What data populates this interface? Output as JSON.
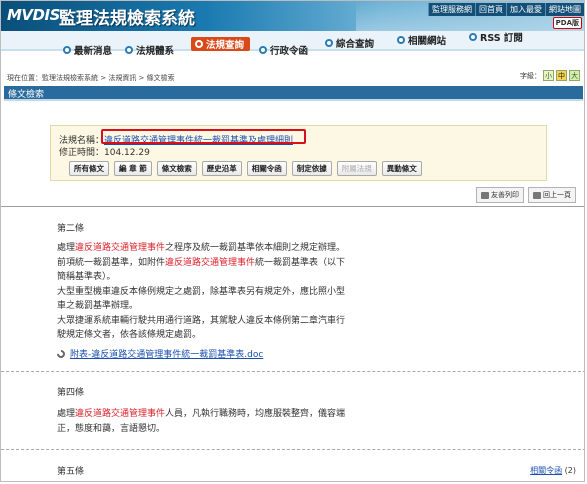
{
  "header": {
    "brand": "MVDIS",
    "title": "監理法規檢索系統",
    "top_links": [
      "監理服務網",
      "回首頁",
      "加入最愛",
      "網站地圖"
    ],
    "pda_label": "PDA版"
  },
  "nav": {
    "items": [
      {
        "label": "最新消息"
      },
      {
        "label": "法規體系"
      },
      {
        "label": "法規查詢"
      },
      {
        "label": "行政令函"
      },
      {
        "label": "綜合查詢"
      },
      {
        "label": "相關網站"
      },
      {
        "label": "RSS 訂閱"
      }
    ]
  },
  "breadcrumb": "現在位置：監理法規檢索系統 > 法規資訊 > 條文檢索",
  "font_size": {
    "label": "字級：",
    "small": "小",
    "medium": "中",
    "large": "大"
  },
  "section_title": "條文檢索",
  "law": {
    "name_label": "法規名稱：",
    "name": "違反道路交通管理事件統一裁罰基準及處理細則",
    "revised_label": "修正時間：",
    "revised": "104.12.29"
  },
  "tabs": [
    "所有條文",
    "編 章 節",
    "條文檢索",
    "歷史沿革",
    "相關令函",
    "制定依據",
    "附屬法規",
    "異動條文"
  ],
  "tools": {
    "print": "友善列印",
    "back": "回上一頁"
  },
  "articles": [
    {
      "title": "第二條",
      "lines": [
        [
          {
            "t": "處理"
          },
          {
            "t": "違反道路交通管理事件",
            "hl": true
          },
          {
            "t": "之程序及統一裁罰基準依本細則之規定辦理。"
          }
        ],
        [
          {
            "t": "前項統一裁罰基準，如附件"
          },
          {
            "t": "違反道路交通管理事件",
            "hl": true
          },
          {
            "t": "統一裁罰基準表（以下"
          }
        ],
        [
          {
            "t": "簡稱基準表）。"
          }
        ],
        [
          {
            "t": "大型重型機車違反本條例規定之處罰，除基準表另有規定外，應比照小型"
          }
        ],
        [
          {
            "t": "車之裁罰基準辦理。"
          }
        ],
        [
          {
            "t": "大眾捷運系統車輛行駛共用通行道路，其駕駛人違反本條例第二章汽車行"
          }
        ],
        [
          {
            "t": "駛規定條文者，依各該條規定處罰。"
          }
        ]
      ],
      "attachment": "附表-違反道路交通管理事件統一裁罰基準表.doc"
    },
    {
      "title": "第四條",
      "lines": [
        [
          {
            "t": "處理"
          },
          {
            "t": "違反道路交通管理事件",
            "hl": true
          },
          {
            "t": "人員，凡執行職務時，均應服裝整齊，儀容端"
          }
        ],
        [
          {
            "t": "正，態度和藹，言語懇切。"
          }
        ]
      ]
    },
    {
      "title": "第五條"
    }
  ],
  "related": {
    "link": "相關令函",
    "count": "(2)"
  }
}
